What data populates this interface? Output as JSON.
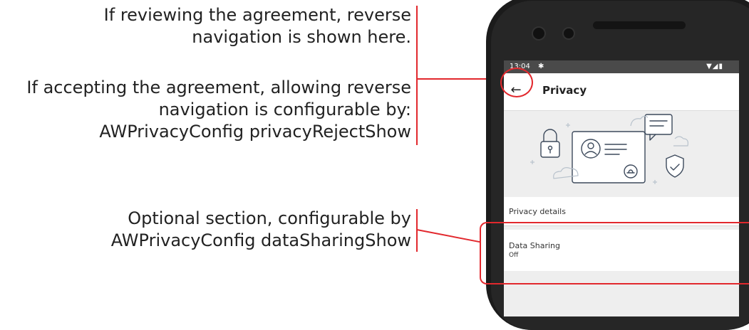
{
  "annotations": {
    "reverse_nav_review": "If reviewing the agreement, reverse navigation is shown here.",
    "reverse_nav_review_lines": [
      "If reviewing the agreement, reverse",
      "navigation is shown here."
    ],
    "reverse_nav_accept": "If accepting the agreement, allowing reverse navigation is configurable by: AWPrivacyConfig privacyRejectShow",
    "reverse_nav_accept_lines": [
      "If accepting the agreement, allowing reverse",
      "navigation is configurable by:",
      "AWPrivacyConfig privacyRejectShow"
    ],
    "optional_section": "Optional section, configurable by AWPrivacyConfig dataSharingShow",
    "optional_section_lines": [
      "Optional section, configurable by",
      "AWPrivacyConfig dataSharingShow"
    ]
  },
  "phone": {
    "status_bar": {
      "time": "13:04"
    },
    "app_bar": {
      "title": "Privacy",
      "back_icon": "arrow-back-icon"
    },
    "hero_icon": "privacy-illustration",
    "sections": [
      {
        "label": "Privacy details"
      },
      {
        "label": "Data Sharing",
        "value": "Off"
      }
    ]
  },
  "colors": {
    "callout_red": "#e2282d",
    "text": "#222222",
    "screen_bg": "#eeeeee",
    "status_bar": "#4a4a4a"
  }
}
